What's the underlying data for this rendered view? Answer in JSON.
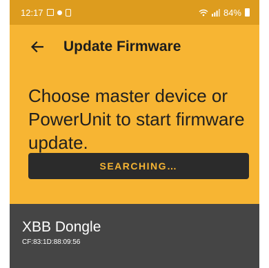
{
  "status_bar": {
    "time": "12:17",
    "battery": "84%"
  },
  "toolbar": {
    "title": "Update Firmware"
  },
  "main": {
    "headline": "Choose master device or PowerUnit to start firmware update.",
    "search_button_label": "SEARCHING…"
  },
  "devices": [
    {
      "name": "XBB Dongle",
      "mac": "CF:83:1D:88:09:56"
    }
  ],
  "colors": {
    "accent": "#f7b533",
    "status_bar": "#dd9c1e",
    "list_bg": "#454545",
    "button_bg": "#2b2b2b"
  }
}
